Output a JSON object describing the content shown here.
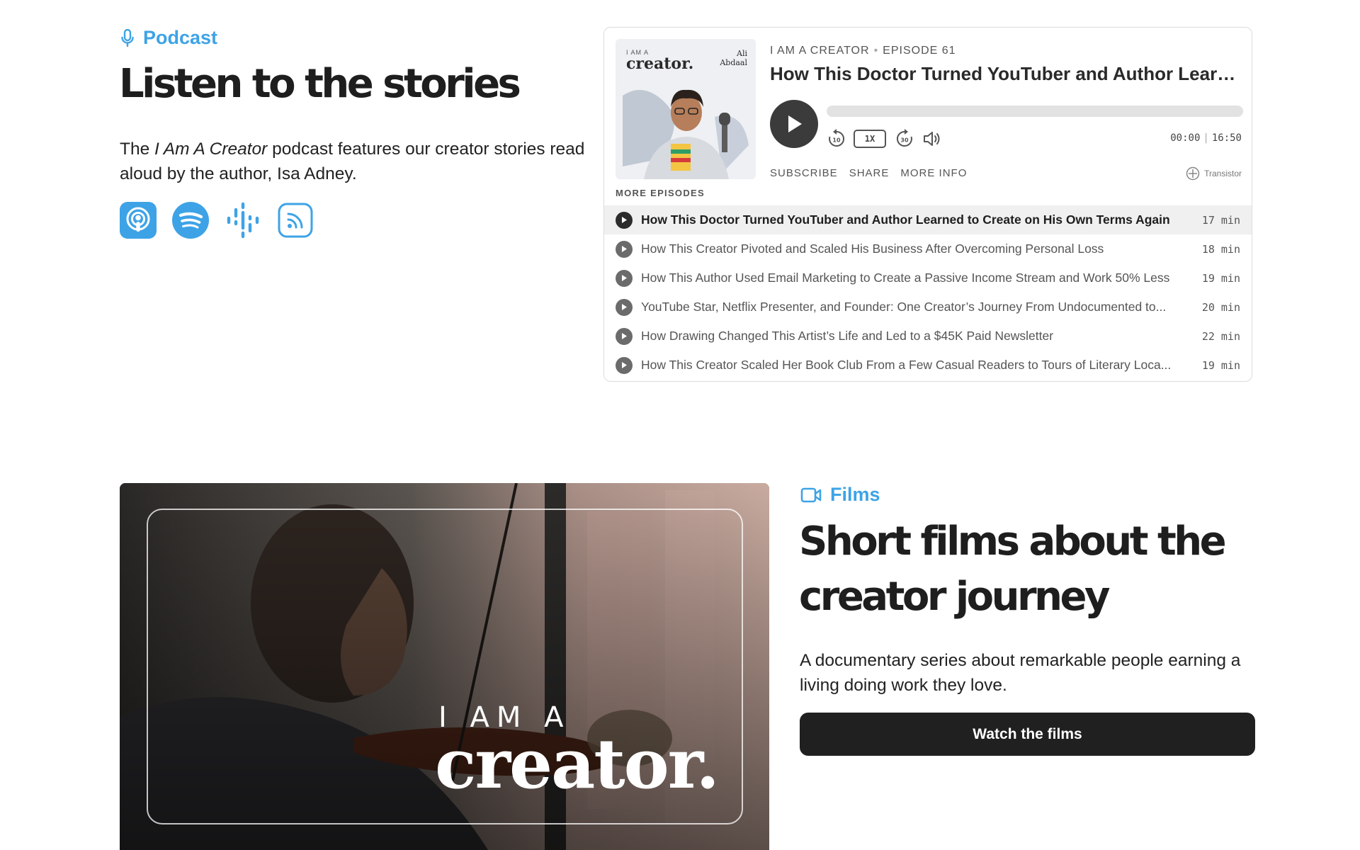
{
  "podcast": {
    "kicker_icon": "microphone-icon",
    "kicker": "Podcast",
    "title": "Listen to the stories",
    "desc_prefix": "The ",
    "desc_italic": "I Am A Creator",
    "desc_suffix": " podcast features our creator stories read aloud by the author, Isa Adney.",
    "accent_color": "#3ea3e6",
    "platforms": [
      "apple-podcasts-icon",
      "spotify-icon",
      "google-podcasts-icon",
      "rss-feed-icon"
    ]
  },
  "player": {
    "cover": {
      "small_text": "I AM A",
      "word": "creator.",
      "name_line1": "Ali",
      "name_line2": "Abdaal"
    },
    "show": "I AM A CREATOR",
    "episode_number": "EPISODE 61",
    "title": "How This Doctor Turned YouTuber and Author Learne...",
    "speed": "1X",
    "rewind_label": "10",
    "forward_label": "30",
    "current_time": "00:00",
    "duration": "16:50",
    "progress_fraction": 0,
    "links": [
      "SUBSCRIBE",
      "SHARE",
      "MORE INFO"
    ],
    "brand": "Transistor",
    "more_label": "MORE EPISODES",
    "episodes": [
      {
        "title": "How This Doctor Turned YouTuber and Author Learned to Create on His Own Terms Again",
        "duration": "17 min",
        "active": true
      },
      {
        "title": "How This Creator Pivoted and Scaled His Business After Overcoming Personal Loss",
        "duration": "18 min",
        "active": false
      },
      {
        "title": "How This Author Used Email Marketing to Create a Passive Income Stream and Work 50% Less",
        "duration": "19 min",
        "active": false
      },
      {
        "title": "YouTube Star, Netflix Presenter, and Founder: One Creator’s Journey From Undocumented to...",
        "duration": "20 min",
        "active": false
      },
      {
        "title": "How Drawing Changed This Artist’s Life and Led to a $45K Paid Newsletter",
        "duration": "22 min",
        "active": false
      },
      {
        "title": "How This Creator Scaled Her Book Club From a Few Casual Readers to Tours of Literary Loca...",
        "duration": "19 min",
        "active": false
      }
    ]
  },
  "films": {
    "kicker_icon": "video-camera-icon",
    "kicker": "Films",
    "title": "Short films about the creator journey",
    "desc": "A documentary series about remarkable people earning a living doing work they love.",
    "image_overlay_small": "I AM A",
    "image_overlay_big": "creator.",
    "button": "Watch the films"
  }
}
